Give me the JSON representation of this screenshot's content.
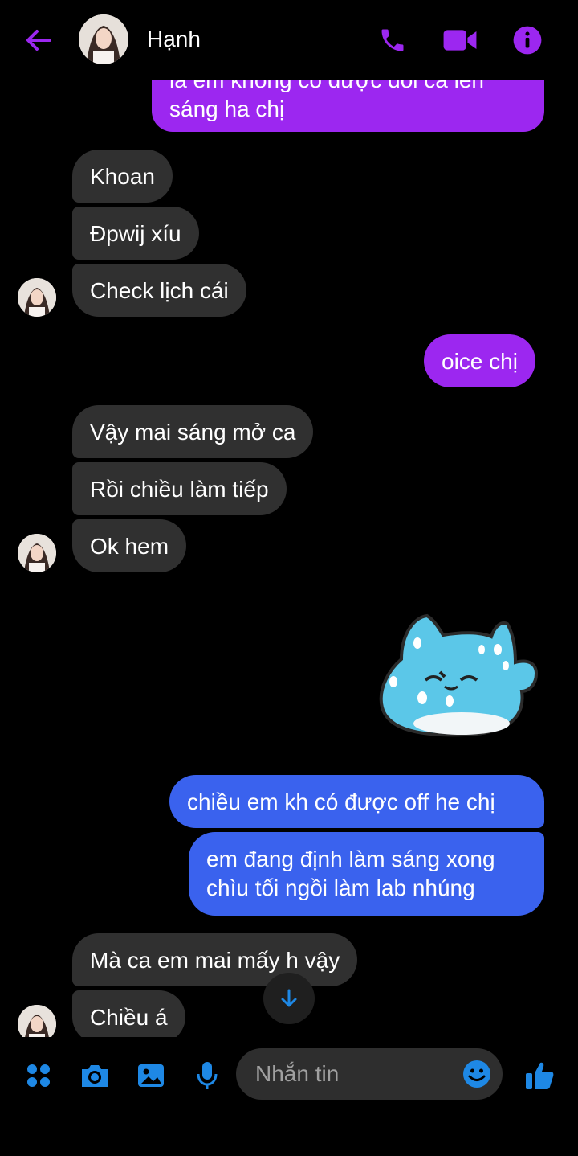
{
  "header": {
    "contact_name": "Hạnh",
    "icons": [
      "back-arrow-icon",
      "phone-icon",
      "video-camera-icon",
      "info-icon"
    ],
    "accent_color": "#9c27f0"
  },
  "messages": [
    {
      "side": "out",
      "text": "là em không có được đổi ca lên sáng ha chị",
      "color": "#9c27f0"
    },
    {
      "side": "in",
      "text": "Khoan"
    },
    {
      "side": "in",
      "text": "Đpwij xíu"
    },
    {
      "side": "in",
      "text": "Check lịch cái"
    },
    {
      "side": "out",
      "text": "oice chị",
      "color": "#9c27f0"
    },
    {
      "side": "in",
      "text": "Vậy mai sáng mở ca"
    },
    {
      "side": "in",
      "text": "Rồi chiều làm tiếp"
    },
    {
      "side": "in",
      "text": "Ok hem"
    },
    {
      "side": "out",
      "type": "sticker",
      "sticker": "blue-cat-sweating-sticker"
    },
    {
      "side": "out",
      "text": "chiều em kh có được off he chị",
      "color": "#3a62ee"
    },
    {
      "side": "out",
      "text": "em đang định làm sáng xong",
      "text2": "chìu tối ngồi làm lab nhúng",
      "color": "#3a62ee"
    },
    {
      "side": "in",
      "text": "Mà ca em mai mấy h vậy"
    },
    {
      "side": "in",
      "text": "Chiều á"
    }
  ],
  "composer": {
    "placeholder": "Nhắn tin",
    "icons": [
      "apps-icon",
      "camera-icon",
      "gallery-icon",
      "microphone-icon",
      "emoji-icon",
      "like-icon"
    ],
    "accent_color": "#1e88e5"
  },
  "scroll_down_icon": "arrow-down-icon"
}
